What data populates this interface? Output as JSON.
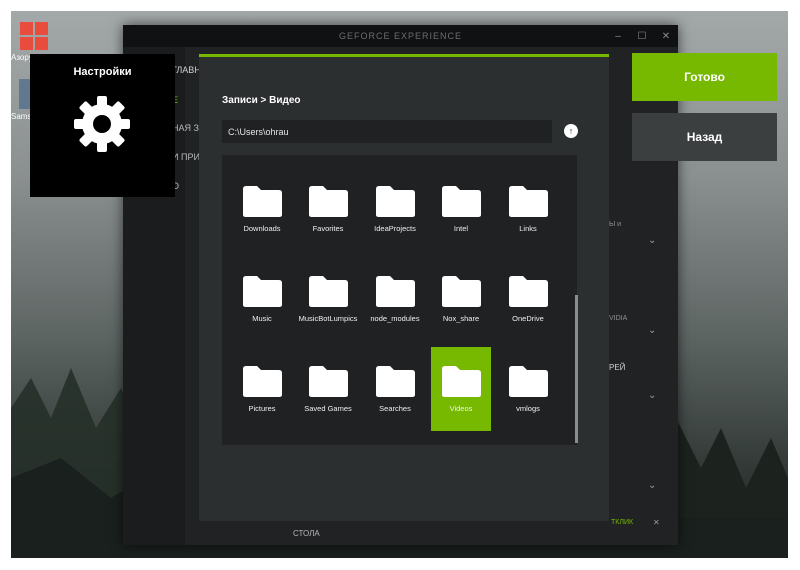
{
  "app": {
    "title": "GEFORCE EXPERIENCE",
    "side_items": [
      "ГЛАВНАЯ",
      "Е",
      "НАЯ ЗА",
      "И ПРИ",
      "О"
    ],
    "bottom_left": "СТОЛА",
    "bottom_right": "ТКЛИК"
  },
  "desktop": {
    "icons": [
      {
        "label": "Азору",
        "icon": "windows-logo-icon"
      },
      {
        "label": "Samsu",
        "icon": "app-icon"
      }
    ]
  },
  "settings_tile": {
    "label": "Настройки",
    "icon": "gear-icon"
  },
  "dialog": {
    "breadcrumb": "Записи > Видео",
    "path_value": "C:\\Users\\ohrau",
    "up_icon": "arrow-up-icon",
    "folders": [
      {
        "name": "Downloads",
        "selected": false
      },
      {
        "name": "Favorites",
        "selected": false
      },
      {
        "name": "IdeaProjects",
        "selected": false
      },
      {
        "name": "Intel",
        "selected": false
      },
      {
        "name": "Links",
        "selected": false
      },
      {
        "name": "Music",
        "selected": false
      },
      {
        "name": "MusicBotLumpics",
        "selected": false
      },
      {
        "name": "node_modules",
        "selected": false
      },
      {
        "name": "Nox_share",
        "selected": false
      },
      {
        "name": "OneDrive",
        "selected": false
      },
      {
        "name": "Pictures",
        "selected": false
      },
      {
        "name": "Saved Games",
        "selected": false
      },
      {
        "name": "Searches",
        "selected": false
      },
      {
        "name": "Videos",
        "selected": true
      },
      {
        "name": "vmlogs",
        "selected": false
      }
    ]
  },
  "buttons": {
    "done": "Готово",
    "back": "Назад"
  },
  "colors": {
    "accent": "#76b900",
    "dialog_bg": "#2c2f30",
    "panel_bg": "#1f2122"
  }
}
